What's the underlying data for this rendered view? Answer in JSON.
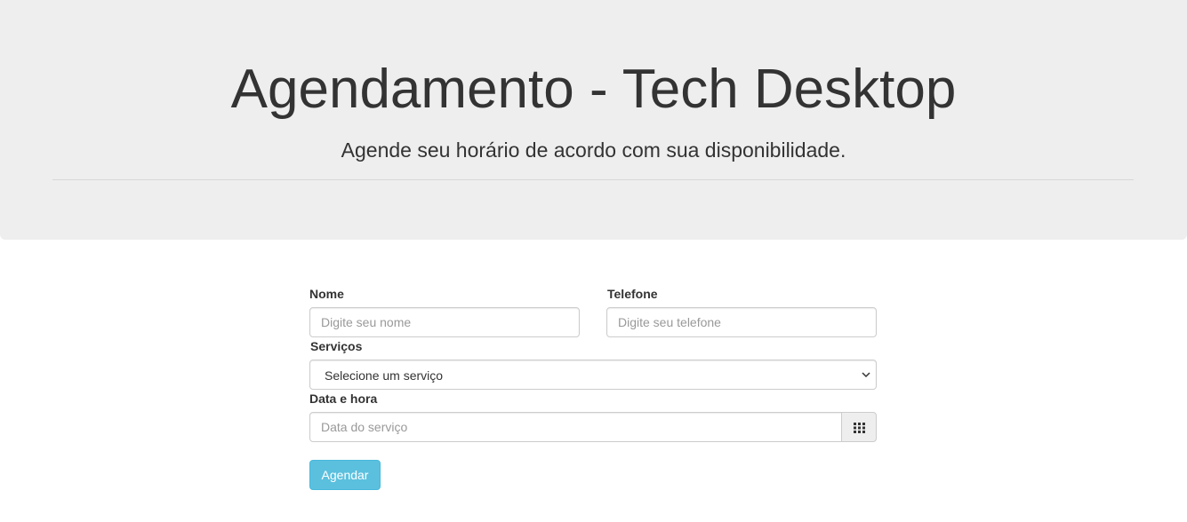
{
  "header": {
    "title": "Agendamento - Tech Desktop",
    "subtitle": "Agende seu horário de acordo com sua disponibilidade."
  },
  "form": {
    "name": {
      "label": "Nome",
      "placeholder": "Digite seu nome",
      "value": ""
    },
    "phone": {
      "label": "Telefone",
      "placeholder": "Digite seu telefone",
      "value": ""
    },
    "service": {
      "label": "Serviços",
      "selected": "Selecione um serviço"
    },
    "datetime": {
      "label": "Data e hora",
      "placeholder": "Data do serviço",
      "value": "",
      "addon_icon": "calendar-grid-icon"
    },
    "submit_label": "Agendar"
  },
  "colors": {
    "header_bg": "#eeeeee",
    "button_bg": "#5bc0de",
    "text": "#333333"
  }
}
